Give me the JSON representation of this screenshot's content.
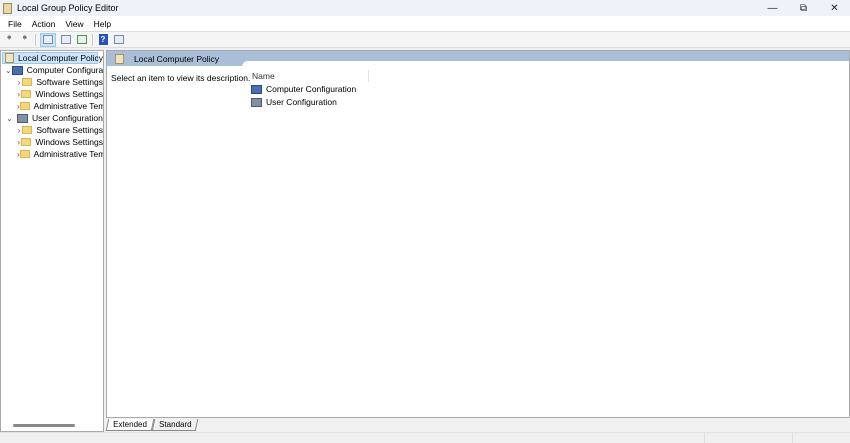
{
  "window": {
    "title": "Local Group Policy Editor"
  },
  "menu": [
    "File",
    "Action",
    "View",
    "Help"
  ],
  "tree": {
    "root": "Local Computer Policy",
    "nodes": [
      {
        "label": "Computer Configuration",
        "children": [
          "Software Settings",
          "Windows Settings",
          "Administrative Templates"
        ]
      },
      {
        "label": "User Configuration",
        "children": [
          "Software Settings",
          "Windows Settings",
          "Administrative Templates"
        ]
      }
    ]
  },
  "details": {
    "header": "Local Computer Policy",
    "description": "Select an item to view its description.",
    "column": "Name",
    "items": [
      "Computer Configuration",
      "User Configuration"
    ]
  },
  "tabs": [
    "Extended",
    "Standard"
  ]
}
